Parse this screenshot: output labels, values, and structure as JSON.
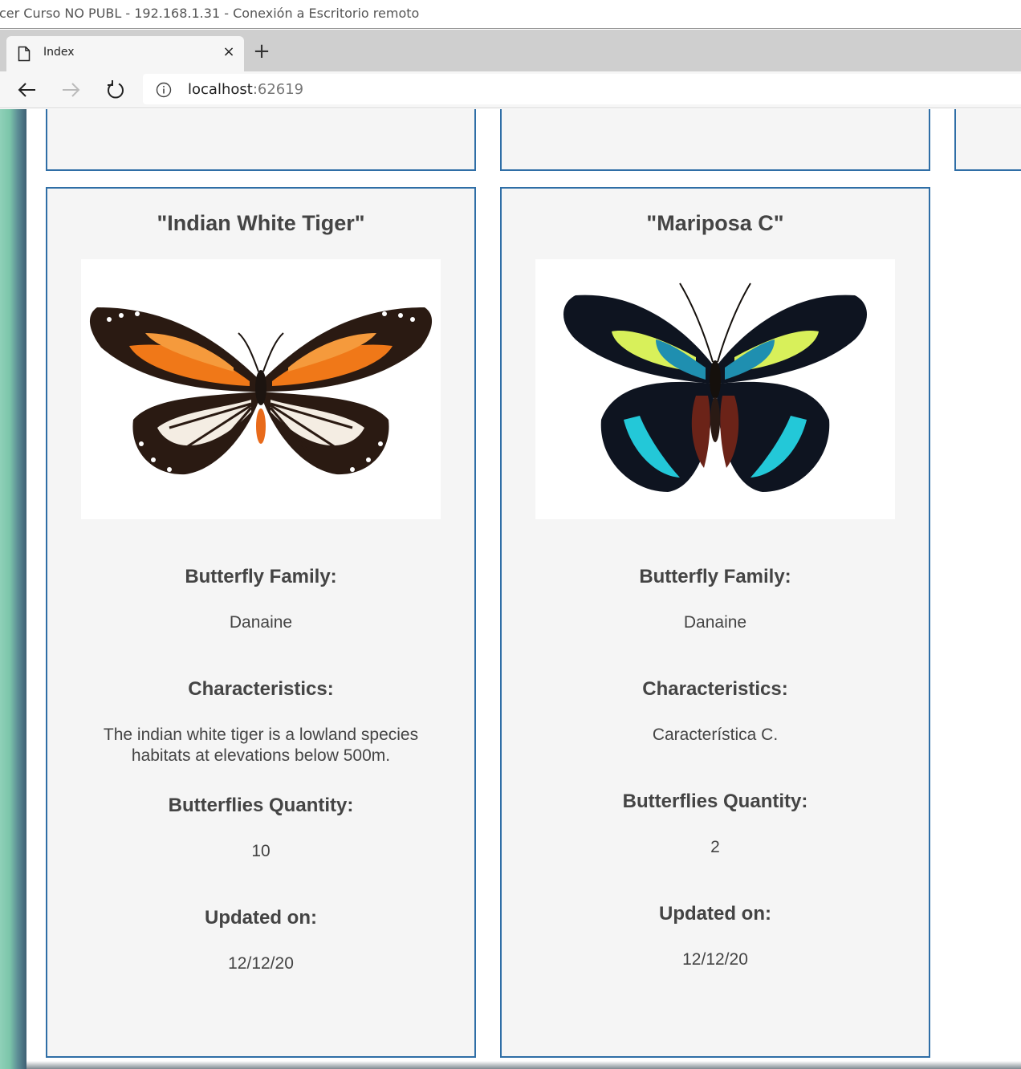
{
  "rdp_window": {
    "title": "cer Curso NO PUBL - 192.168.1.31 - Conexión a Escritorio remoto"
  },
  "browser": {
    "tab_title": "Index",
    "tab_close": "×",
    "new_tab": "+",
    "url_host": "localhost",
    "url_port": ":62619"
  },
  "cards": [
    {
      "title": "\"Indian White Tiger\"",
      "family_label": "Butterfly Family:",
      "family": "Danaine",
      "characteristics_label": "Characteristics:",
      "characteristics": "The indian white tiger is a lowland species habitats at elevations below 500m.",
      "quantity_label": "Butterflies Quantity:",
      "quantity": "10",
      "updated_label": "Updated on:",
      "updated": "12/12/20"
    },
    {
      "title": "\"Mariposa C\"",
      "family_label": "Butterfly Family:",
      "family": "Danaine",
      "characteristics_label": "Characteristics:",
      "characteristics": "Característica C.",
      "quantity_label": "Butterflies Quantity:",
      "quantity": "2",
      "updated_label": "Updated on:",
      "updated": "12/12/20"
    }
  ]
}
